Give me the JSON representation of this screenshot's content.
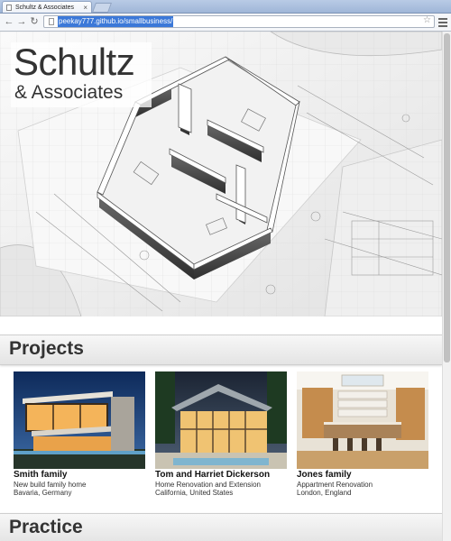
{
  "browser": {
    "tab_title": "Schultz & Associates",
    "tab_close": "×",
    "url": "peekay777.github.io/smallbusiness/",
    "back": "←",
    "forward": "→",
    "reload": "↻",
    "star": "☆"
  },
  "hero": {
    "title": "Schultz",
    "subtitle": "& Associates"
  },
  "projects": {
    "heading": "Projects",
    "items": [
      {
        "name": "Smith family",
        "description": "New build family home",
        "location": "Bavaria, Germany"
      },
      {
        "name": "Tom and Harriet Dickerson",
        "description": "Home Renovation and Extension",
        "location": "California, United States"
      },
      {
        "name": "Jones family",
        "description": "Appartment Renovation",
        "location": "London, England"
      }
    ]
  },
  "practice": {
    "heading": "Practice"
  },
  "colors": {
    "url_highlight": "#3b78d8",
    "section_bar": "#ececec"
  }
}
